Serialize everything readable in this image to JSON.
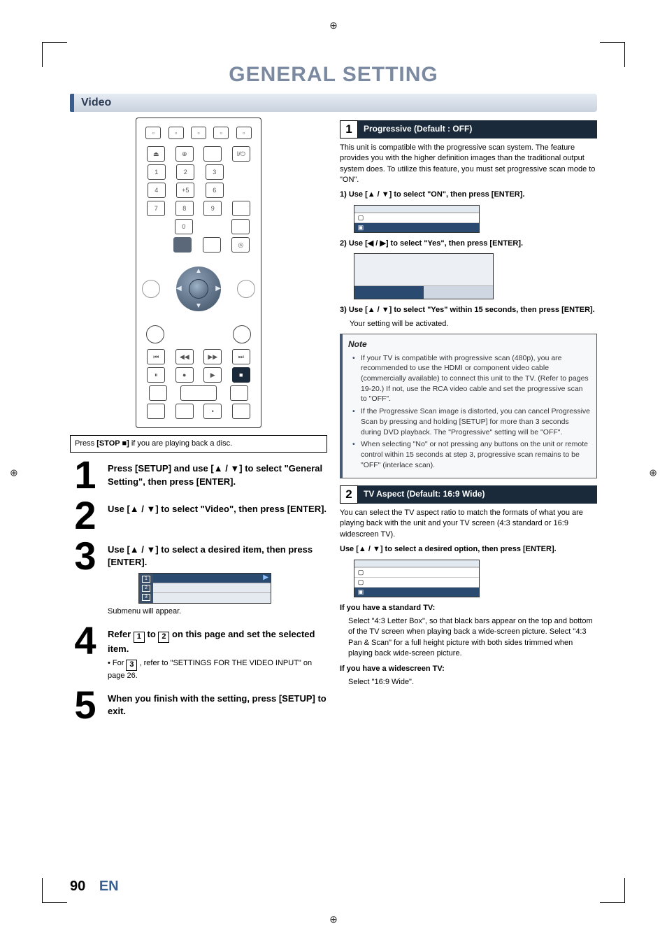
{
  "page": {
    "title": "GENERAL SETTING",
    "section": "Video",
    "page_number": "90",
    "lang": "EN"
  },
  "remote": {
    "stop_caption_pre": "Press ",
    "stop_caption_bold": "[STOP ■]",
    "stop_caption_post": " if you are playing back a disc.",
    "keys": {
      "eject": "⏏",
      "power": "I/⏻",
      "n1": "1",
      "n2": "2",
      "n3": "3",
      "n4": "4",
      "n5": "+5",
      "n6": "6",
      "n7": "7",
      "n8": "8",
      "n9": "9",
      "n0": "0",
      "skip_back": "⏮",
      "rew": "◀◀",
      "ff": "▶▶",
      "skip_fwd": "⏭",
      "pause": "⏸",
      "rec": "●",
      "play": "▶",
      "stop": "■",
      "disc_icon": "◎"
    }
  },
  "steps": [
    {
      "num": "1",
      "body": "Press [SETUP] and use [▲ / ▼] to select \"General Setting\", then press [ENTER]."
    },
    {
      "num": "2",
      "body": "Use [▲ / ▼] to select \"Video\", then press [ENTER]."
    },
    {
      "num": "3",
      "body": "Use [▲ / ▼] to select a desired item, then press [ENTER].",
      "submenu_caption": "Submenu will appear."
    },
    {
      "num": "4",
      "body_pre": "Refer ",
      "body_mid": " to ",
      "body_post": " on this page and set the selected item.",
      "ref1": "1",
      "ref2": "2",
      "sub_pre": "• For ",
      "sub_ref": "3",
      "sub_post": " , refer to \"SETTINGS FOR THE VIDEO INPUT\" on page 26."
    },
    {
      "num": "5",
      "body": "When you finish with the setting, press [SETUP] to exit."
    }
  ],
  "mini_menu_side": [
    "1",
    "2",
    "3"
  ],
  "right": {
    "sec1": {
      "num": "1",
      "title": "Progressive (Default : OFF)",
      "intro": "This unit is compatible with the progressive scan system. The feature provides you with the higher definition images than the traditional output system does. To utilize this feature, you must set progressive scan mode to \"ON\".",
      "step1": "1) Use [▲ / ▼] to select \"ON\", then press [ENTER].",
      "step2": "2) Use [◀ / ▶] to select \"Yes\", then press [ENTER].",
      "step3_a": "3) Use [▲ / ▼] to select \"Yes\" within 15 seconds, then press [ENTER].",
      "step3_b": "Your setting will be activated."
    },
    "note": {
      "title": "Note",
      "items": [
        "If your TV is compatible with progressive scan (480p), you are recommended to use the HDMI or component video cable (commercially available) to connect this unit to the TV. (Refer to pages 19-20.) If not, use the RCA video cable and set the progressive scan to \"OFF\".",
        "If the Progressive Scan image is distorted, you can cancel Progressive Scan by pressing and holding [SETUP] for more than 3 seconds during DVD playback. The \"Progressive\" setting will be \"OFF\".",
        "When selecting \"No\" or not pressing any buttons on the unit or remote control within 15 seconds at step 3, progressive scan remains to be \"OFF\" (interlace scan)."
      ]
    },
    "sec2": {
      "num": "2",
      "title": "TV Aspect (Default: 16:9 Wide)",
      "intro": "You can select the TV aspect ratio to match the formats of what you are playing back with the unit and your TV screen (4:3 standard or 16:9 widescreen TV).",
      "instr": "Use [▲ / ▼] to select a desired option, then press [ENTER].",
      "std_h": "If you have a standard TV:",
      "std_b": "Select \"4:3 Letter Box\", so that black bars appear on the top and bottom of the TV screen when playing back a wide-screen picture. Select \"4:3 Pan & Scan\" for a full height picture with both sides trimmed when playing back wide-screen picture.",
      "wide_h": "If you have a widescreen TV:",
      "wide_b": "Select \"16:9 Wide\"."
    }
  },
  "marks": {
    "reg": "⊕"
  }
}
